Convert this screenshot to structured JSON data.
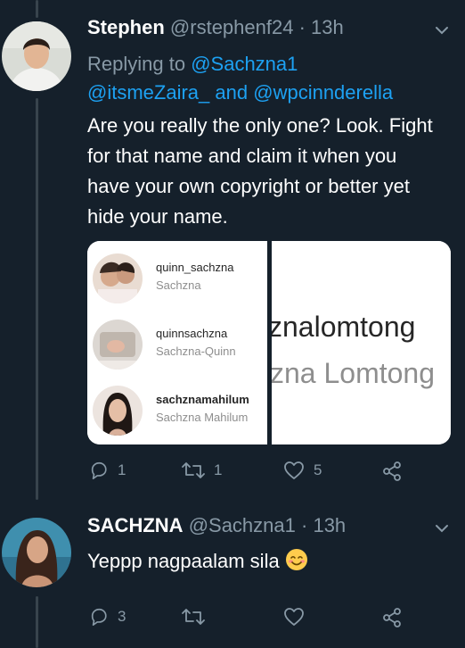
{
  "tweets": [
    {
      "name": "Stephen",
      "handle": "@rstephenf24",
      "separator": "·",
      "time": "13h",
      "replying_prefix": "Replying to",
      "replying_to": [
        "@Sachzna1",
        "@itsmeZaira_",
        "@wpcinnderella"
      ],
      "replying_and": "and",
      "text": "Are you really the only one? Look. Fight for that name and claim it when you have your own copyright or better yet hide your name.",
      "media": {
        "accounts": [
          {
            "username": "quinn_sachzna",
            "display": "Sachzna"
          },
          {
            "username": "quinnsachzna",
            "display": "Sachzna-Quinn"
          },
          {
            "username": "sachznamahilum",
            "display": "Sachzna Mahilum"
          }
        ],
        "zoom_username": "znalomtong",
        "zoom_display": "zna Lomtong"
      },
      "actions": {
        "reply_count": "1",
        "retweet_count": "1",
        "like_count": "5"
      }
    },
    {
      "name": "SACHZNA",
      "handle": "@Sachzna1",
      "separator": "·",
      "time": "13h",
      "text": "Yeppp nagpaalam sila",
      "emoji": "smiling-face-emoji",
      "actions": {
        "reply_count": "3",
        "retweet_count": "",
        "like_count": ""
      }
    }
  ],
  "colors": {
    "background": "#15202b",
    "secondary_text": "#8899a6",
    "link": "#1da1f2",
    "thread_line": "#38444d"
  }
}
